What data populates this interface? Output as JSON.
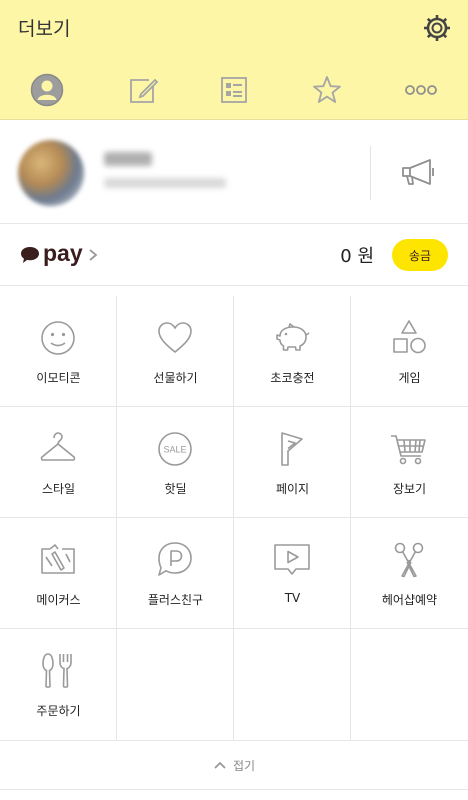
{
  "header": {
    "title": "더보기",
    "settings_icon": "gear-icon",
    "tabs": [
      {
        "name": "profile",
        "icon": "person-icon"
      },
      {
        "name": "note",
        "icon": "edit-icon"
      },
      {
        "name": "list",
        "icon": "list-icon"
      },
      {
        "name": "favorites",
        "icon": "star-icon"
      },
      {
        "name": "more",
        "icon": "ellipsis-icon"
      }
    ]
  },
  "profile": {
    "avatar_icon": "avatar",
    "notice_icon": "megaphone-icon"
  },
  "pay": {
    "brand": "pay",
    "balance": "0 원",
    "send_label": "송금",
    "accent_color": "#fde500"
  },
  "menu": [
    {
      "label": "이모티콘",
      "icon": "emoticon-icon"
    },
    {
      "label": "선물하기",
      "icon": "heart-icon"
    },
    {
      "label": "초코충전",
      "icon": "piggybank-icon"
    },
    {
      "label": "게임",
      "icon": "shapes-icon"
    },
    {
      "label": "스타일",
      "icon": "hanger-icon"
    },
    {
      "label": "핫딜",
      "icon": "sale-icon"
    },
    {
      "label": "페이지",
      "icon": "page-icon"
    },
    {
      "label": "장보기",
      "icon": "cart-icon"
    },
    {
      "label": "메이커스",
      "icon": "makers-icon"
    },
    {
      "label": "플러스친구",
      "icon": "plusfriend-icon"
    },
    {
      "label": "TV",
      "icon": "tv-icon"
    },
    {
      "label": "헤어샵예약",
      "icon": "scissors-icon"
    },
    {
      "label": "주문하기",
      "icon": "utensils-icon"
    }
  ],
  "footer": {
    "collapse_label": "접기"
  },
  "colors": {
    "header_bg": "#fdf6a7",
    "icon_gray": "#9a9a9a"
  }
}
